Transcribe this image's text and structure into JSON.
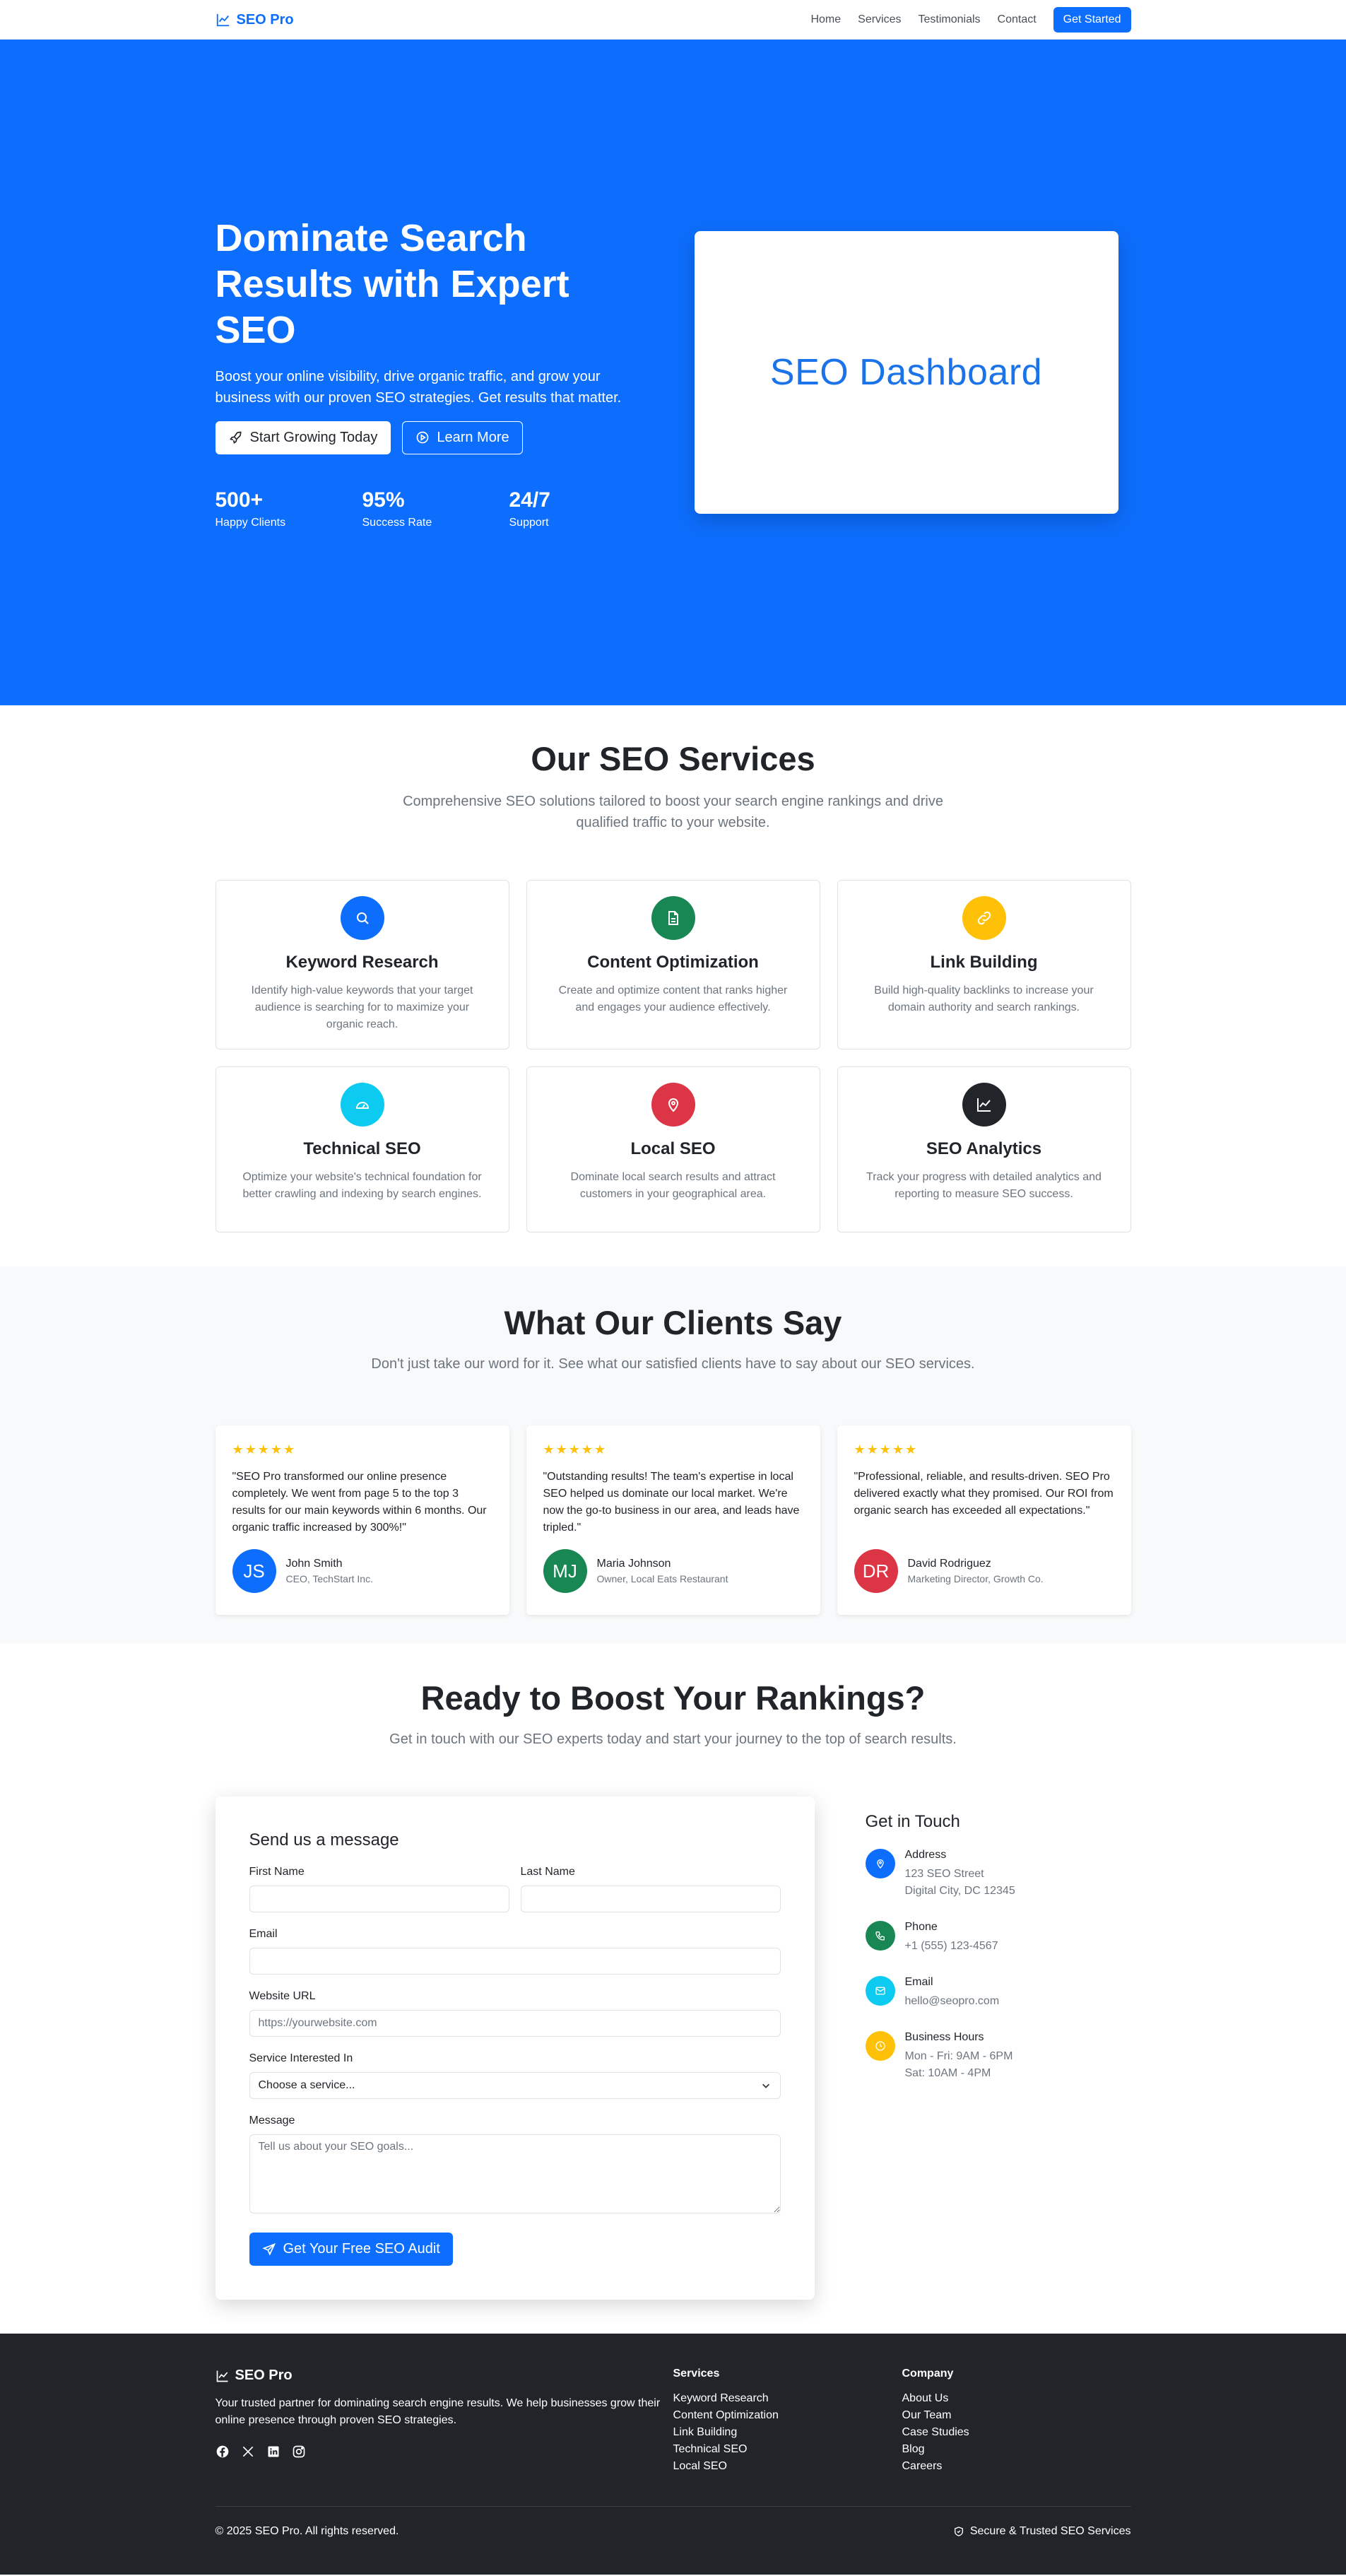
{
  "nav": {
    "brand": "SEO Pro",
    "links": [
      "Home",
      "Services",
      "Testimonials",
      "Contact"
    ],
    "cta": "Get Started"
  },
  "hero": {
    "title": "Dominate Search Results with Expert SEO",
    "subtitle": "Boost your online visibility, drive organic traffic, and grow your business with our proven SEO strategies. Get results that matter.",
    "primary_btn": "Start Growing Today",
    "secondary_btn": "Learn More",
    "stats": [
      {
        "num": "500+",
        "label": "Happy Clients"
      },
      {
        "num": "95%",
        "label": "Success Rate"
      },
      {
        "num": "24/7",
        "label": "Support"
      }
    ],
    "dashboard_text": "SEO Dashboard"
  },
  "services": {
    "title": "Our SEO Services",
    "subtitle": "Comprehensive SEO solutions tailored to boost your search engine rankings and drive qualified traffic to your website.",
    "items": [
      {
        "title": "Keyword Research",
        "desc": "Identify high-value keywords that your target audience is searching for to maximize your organic reach.",
        "icon": "search-icon",
        "color": "#0d6efd"
      },
      {
        "title": "Content Optimization",
        "desc": "Create and optimize content that ranks higher and engages your audience effectively.",
        "icon": "document-icon",
        "color": "#198754"
      },
      {
        "title": "Link Building",
        "desc": "Build high-quality backlinks to increase your domain authority and search rankings.",
        "icon": "link-icon",
        "color": "#ffc107"
      },
      {
        "title": "Technical SEO",
        "desc": "Optimize your website's technical foundation for better crawling and indexing by search engines.",
        "icon": "speedometer-icon",
        "color": "#0dcaf0"
      },
      {
        "title": "Local SEO",
        "desc": "Dominate local search results and attract customers in your geographical area.",
        "icon": "map-pin-icon",
        "color": "#dc3545"
      },
      {
        "title": "SEO Analytics",
        "desc": "Track your progress with detailed analytics and reporting to measure SEO success.",
        "icon": "chart-line-icon",
        "color": "#212529"
      }
    ]
  },
  "testimonials": {
    "title": "What Our Clients Say",
    "subtitle": "Don't just take our word for it. See what our satisfied clients have to say about our SEO services.",
    "stars": "★★★★★",
    "items": [
      {
        "quote": "\"SEO Pro transformed our online presence completely. We went from page 5 to the top 3 results for our main keywords within 6 months. Our organic traffic increased by 300%!\"",
        "initials": "JS",
        "name": "John Smith",
        "role": "CEO, TechStart Inc.",
        "color": "#0d6efd"
      },
      {
        "quote": "\"Outstanding results! The team's expertise in local SEO helped us dominate our local market. We're now the go-to business in our area, and leads have tripled.\"",
        "initials": "MJ",
        "name": "Maria Johnson",
        "role": "Owner, Local Eats Restaurant",
        "color": "#198754"
      },
      {
        "quote": "\"Professional, reliable, and results-driven. SEO Pro delivered exactly what they promised. Our ROI from organic search has exceeded all expectations.\"",
        "initials": "DR",
        "name": "David Rodriguez",
        "role": "Marketing Director, Growth Co.",
        "color": "#dc3545"
      }
    ]
  },
  "contact": {
    "title": "Ready to Boost Your Rankings?",
    "subtitle": "Get in touch with our SEO experts today and start your journey to the top of search results.",
    "form": {
      "title": "Send us a message",
      "first_name_label": "First Name",
      "last_name_label": "Last Name",
      "email_label": "Email",
      "website_label": "Website URL",
      "website_placeholder": "https://yourwebsite.com",
      "service_label": "Service Interested In",
      "service_value": "Choose a service...",
      "message_label": "Message",
      "message_placeholder": "Tell us about your SEO goals...",
      "submit": "Get Your Free SEO Audit"
    },
    "info": {
      "title": "Get in Touch",
      "items": [
        {
          "head": "Address",
          "lines": [
            "123 SEO Street",
            "Digital City, DC 12345"
          ],
          "icon": "map-pin-icon",
          "color": "#0d6efd"
        },
        {
          "head": "Phone",
          "lines": [
            "+1 (555) 123-4567"
          ],
          "icon": "phone-icon",
          "color": "#198754"
        },
        {
          "head": "Email",
          "lines": [
            "hello@seopro.com"
          ],
          "icon": "envelope-icon",
          "color": "#0dcaf0"
        },
        {
          "head": "Business Hours",
          "lines": [
            "Mon - Fri: 9AM - 6PM",
            "Sat: 10AM - 4PM"
          ],
          "icon": "clock-icon",
          "color": "#ffc107"
        }
      ]
    }
  },
  "footer": {
    "brand": "SEO Pro",
    "desc": "Your trusted partner for dominating search engine results. We help businesses grow their online presence through proven SEO strategies.",
    "services_title": "Services",
    "services": [
      "Keyword Research",
      "Content Optimization",
      "Link Building",
      "Technical SEO",
      "Local SEO"
    ],
    "company_title": "Company",
    "company": [
      "About Us",
      "Our Team",
      "Case Studies",
      "Blog",
      "Careers"
    ],
    "copyright": "© 2025 SEO Pro. All rights reserved.",
    "secure": "Secure & Trusted SEO Services"
  }
}
